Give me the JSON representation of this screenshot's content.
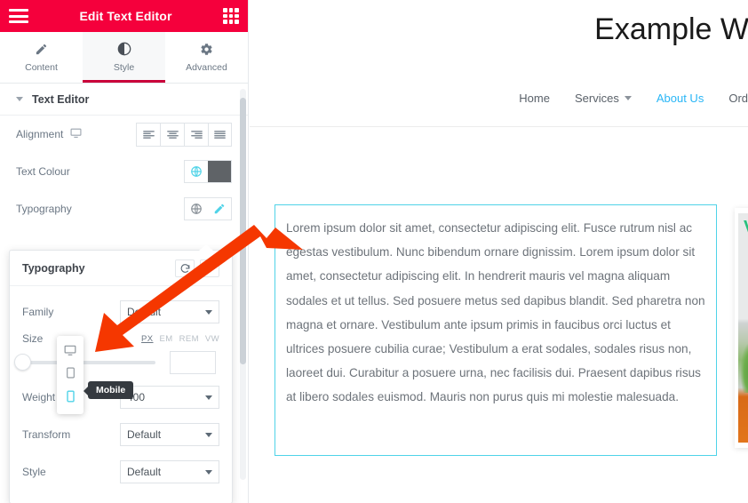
{
  "panel": {
    "header": {
      "title": "Edit Text Editor",
      "menu_icon": "hamburger-icon",
      "apps_icon": "grid-icon",
      "accent_color": "#F5003C"
    },
    "tabs": [
      {
        "label": "Content",
        "icon": "pencil-icon",
        "active": false
      },
      {
        "label": "Style",
        "icon": "contrast-icon",
        "active": true
      },
      {
        "label": "Advanced",
        "icon": "gear-icon",
        "active": false
      }
    ],
    "section": {
      "title": "Text Editor",
      "expanded": true
    },
    "controls": {
      "alignment": {
        "label": "Alignment",
        "device_icon": "desktop-icon",
        "options": [
          "align-left",
          "align-center",
          "align-right",
          "align-justify"
        ]
      },
      "text_colour": {
        "label": "Text Colour",
        "globe_icon": "globe-icon",
        "swatch_color": "#5f6367"
      },
      "typography": {
        "label": "Typography",
        "globe_icon": "globe-icon",
        "edit_icon": "pencil-icon"
      }
    }
  },
  "typography_popover": {
    "title": "Typography",
    "reset_icon": "reset-icon",
    "add_icon": "plus-icon",
    "fields": {
      "family": {
        "label": "Family",
        "value": "Default"
      },
      "size": {
        "label": "Size",
        "units": [
          "PX",
          "EM",
          "REM",
          "VW"
        ],
        "active_unit": "PX",
        "value": "",
        "slider_percent": 0
      },
      "weight": {
        "label": "Weight",
        "value": "400"
      },
      "transform": {
        "label": "Transform",
        "value": "Default"
      },
      "style": {
        "label": "Style",
        "value": "Default"
      }
    },
    "device_selector": {
      "items": [
        {
          "name": "desktop-icon",
          "active": false
        },
        {
          "name": "tablet-icon",
          "active": false
        },
        {
          "name": "mobile-icon",
          "active": true
        }
      ],
      "tooltip": "Mobile",
      "active_color": "#4fd3e8"
    }
  },
  "preview": {
    "site_title": "Example W",
    "nav": [
      {
        "label": "Home",
        "active": false,
        "has_caret": false
      },
      {
        "label": "Services",
        "active": false,
        "has_caret": true
      },
      {
        "label": "About Us",
        "active": true,
        "has_caret": false
      },
      {
        "label": "Ord",
        "active": false,
        "has_caret": false
      }
    ],
    "text_widget": {
      "selected": true,
      "border_color": "#4fd3e8",
      "body": "Lorem ipsum dolor sit amet, consectetur adipiscing elit. Fusce rutrum nisl ac egestas vestibulum. Nunc bibendum ornare dignissim. Lorem ipsum dolor sit amet, consectetur adipiscing elit. In hendrerit mauris vel magna aliquam sodales et ut tellus. Sed posuere metus sed dapibus blandit. Sed pharetra non magna et ornare. Vestibulum ante ipsum primis in faucibus orci luctus et ultrices posuere cubilia curae; Vestibulum a erat sodales, sodales risus non, laoreet dui. Curabitur a posuere urna, nec facilisis dui. Praesent dapibus risus at libero sodales euismod. Mauris non purus quis mi molestie malesuada."
    },
    "image_card": {
      "check_mark": "V",
      "visible_portion": "partial"
    }
  },
  "annotation": {
    "arrow_color": "#F53700",
    "points_to": "device-selector"
  }
}
